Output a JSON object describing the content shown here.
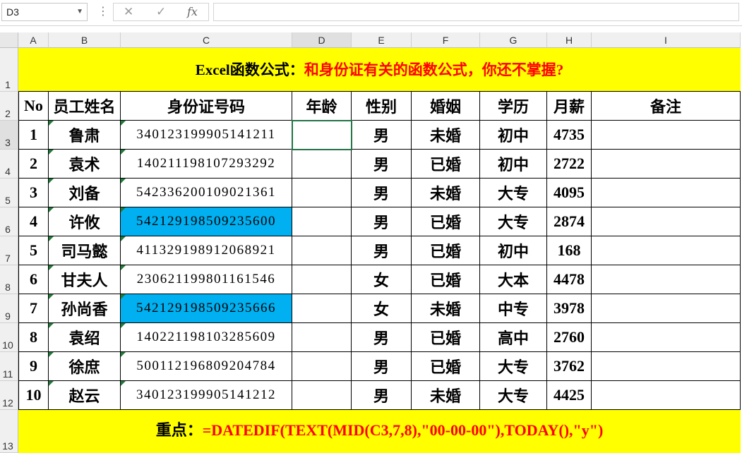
{
  "toolbar": {
    "name_box": "D3",
    "formula_value": ""
  },
  "columns": [
    "A",
    "B",
    "C",
    "D",
    "E",
    "F",
    "G",
    "H",
    "I"
  ],
  "rows": [
    "1",
    "2",
    "3",
    "4",
    "5",
    "6",
    "7",
    "8",
    "9",
    "10",
    "11",
    "12",
    "13"
  ],
  "title": {
    "black": "Excel函数公式：",
    "red": "和身份证有关的函数公式，你还不掌握?"
  },
  "headers": [
    "No",
    "员工姓名",
    "身份证号码",
    "年龄",
    "性别",
    "婚姻",
    "学历",
    "月薪",
    "备注"
  ],
  "table": [
    {
      "no": "1",
      "name": "鲁肃",
      "id": "340123199905141211",
      "age": "",
      "sex": "男",
      "marriage": "未婚",
      "edu": "初中",
      "salary": "4735",
      "note": "",
      "highlight": false
    },
    {
      "no": "2",
      "name": "袁术",
      "id": "140211198107293292",
      "age": "",
      "sex": "男",
      "marriage": "已婚",
      "edu": "初中",
      "salary": "2722",
      "note": "",
      "highlight": false
    },
    {
      "no": "3",
      "name": "刘备",
      "id": "542336200109021361",
      "age": "",
      "sex": "男",
      "marriage": "未婚",
      "edu": "大专",
      "salary": "4095",
      "note": "",
      "highlight": false
    },
    {
      "no": "4",
      "name": "许攸",
      "id": "542129198509235600",
      "age": "",
      "sex": "男",
      "marriage": "已婚",
      "edu": "大专",
      "salary": "2874",
      "note": "",
      "highlight": true
    },
    {
      "no": "5",
      "name": "司马懿",
      "id": "411329198912068921",
      "age": "",
      "sex": "男",
      "marriage": "已婚",
      "edu": "初中",
      "salary": "168",
      "note": "",
      "highlight": false
    },
    {
      "no": "6",
      "name": "甘夫人",
      "id": "230621199801161546",
      "age": "",
      "sex": "女",
      "marriage": "已婚",
      "edu": "大本",
      "salary": "4478",
      "note": "",
      "highlight": false
    },
    {
      "no": "7",
      "name": "孙尚香",
      "id": "542129198509235666",
      "age": "",
      "sex": "女",
      "marriage": "未婚",
      "edu": "中专",
      "salary": "3978",
      "note": "",
      "highlight": true
    },
    {
      "no": "8",
      "name": "袁绍",
      "id": "140221198103285609",
      "age": "",
      "sex": "男",
      "marriage": "已婚",
      "edu": "高中",
      "salary": "2760",
      "note": "",
      "highlight": false
    },
    {
      "no": "9",
      "name": "徐庶",
      "id": "500112196809204784",
      "age": "",
      "sex": "男",
      "marriage": "已婚",
      "edu": "大专",
      "salary": "3762",
      "note": "",
      "highlight": false
    },
    {
      "no": "10",
      "name": "赵云",
      "id": "340123199905141212",
      "age": "",
      "sex": "男",
      "marriage": "未婚",
      "edu": "大专",
      "salary": "4425",
      "note": "",
      "highlight": false
    }
  ],
  "footer": {
    "black": "重点：",
    "red": "=DATEDIF(TEXT(MID(C3,7,8),\"00-00-00\"),TODAY(),\"y\")"
  },
  "colors": {
    "banner": "#ffff00",
    "red_text": "#ff0000",
    "id_highlight": "#00b0f0",
    "selection": "#217346"
  }
}
